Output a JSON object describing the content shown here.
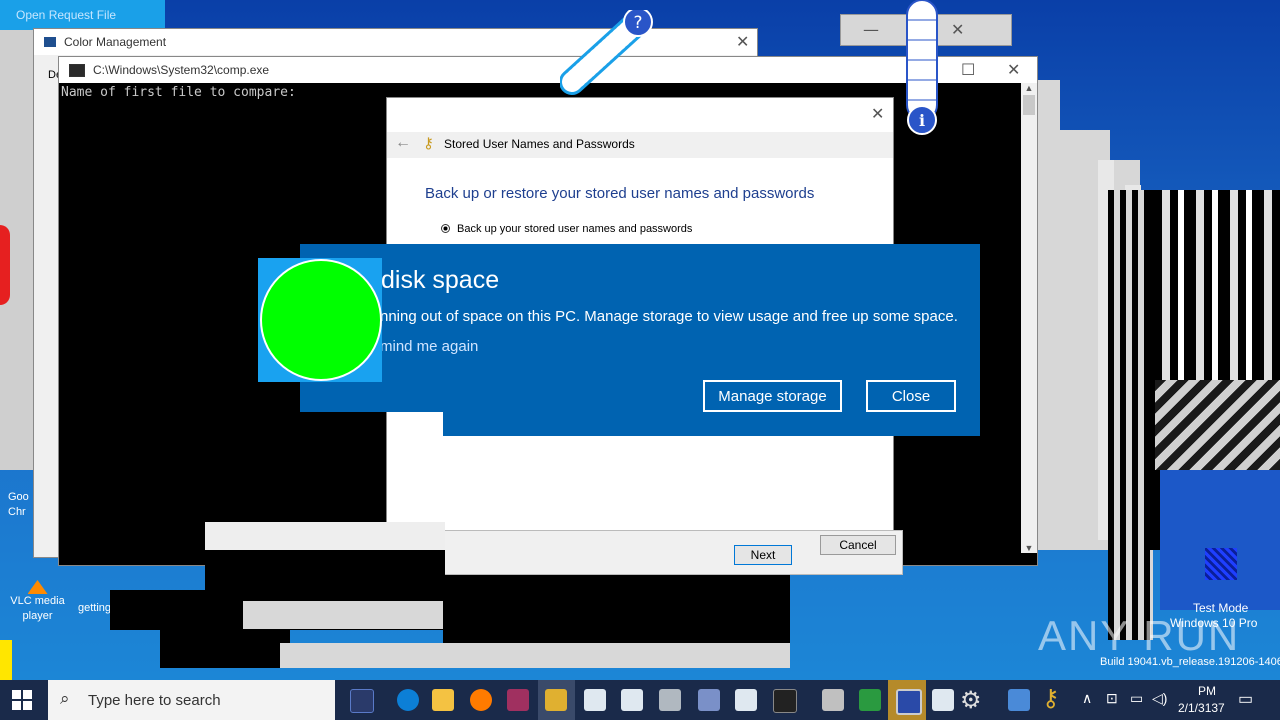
{
  "windows": {
    "open_request": {
      "title": "Open Request File"
    },
    "color_mgmt": {
      "title": "Color Management",
      "tab_fragment": "De"
    },
    "comp": {
      "title": "C:\\Windows\\System32\\comp.exe",
      "prompt": "Name of first file to compare:"
    },
    "stored": {
      "title": "Stored User Names and Passwords",
      "heading": "Back up or restore your stored user names and passwords",
      "radio_backup": "Back up your stored user names and passwords",
      "next": "Next",
      "cancel": "Cancel"
    }
  },
  "toast": {
    "title": "disk space",
    "message": "nning out of space on this PC. Manage storage to view usage and free up some space.",
    "remind": "mind me again",
    "manage_label": "Manage storage",
    "close_label": "Close"
  },
  "desktop_icons": {
    "chrome": "Goo\nChr",
    "vlc": "VLC media\nplayer",
    "getting": "getting"
  },
  "watermark": {
    "brand": "ANY RUN",
    "test_mode": "Test Mode",
    "win_version": "Windows 10 Pro",
    "build": "Build 19041.vb_release.191206-1406"
  },
  "taskbar": {
    "search_placeholder": "Type here to search",
    "time": "PM",
    "date": "2/1/3137"
  },
  "colors": {
    "toast_bg": "#0063b1",
    "taskbar_bg": "#1a2a4a",
    "green_circle": "#00ff00"
  }
}
